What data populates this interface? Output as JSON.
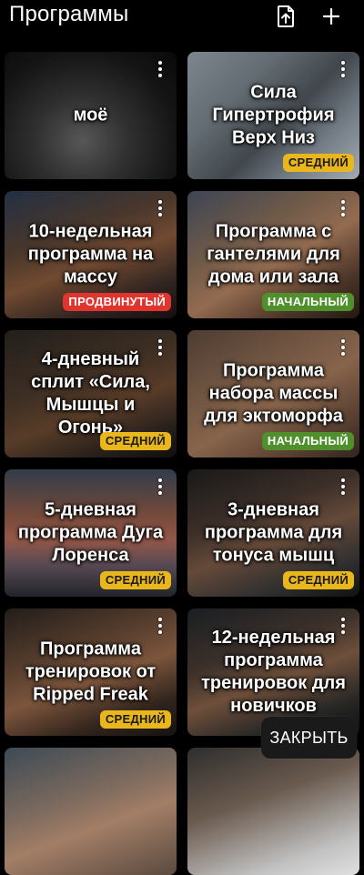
{
  "header": {
    "title": "Программы",
    "import_icon": "file-upload-icon",
    "add_icon": "plus-icon"
  },
  "programs": [
    {
      "title": "моё",
      "level": "",
      "level_kind": "none"
    },
    {
      "title": "Сила Гипертрофия Верх Низ",
      "level": "СРЕДНИЙ",
      "level_kind": "intermediate"
    },
    {
      "title": "10-недельная программа на массу",
      "level": "ПРОДВИНУТЫЙ",
      "level_kind": "advanced"
    },
    {
      "title": "Программа с гантелями для дома или зала",
      "level": "НАЧАЛЬНЫЙ",
      "level_kind": "beginner"
    },
    {
      "title": "4-дневный сплит «Сила, Мышцы и Огонь»",
      "level": "СРЕДНИЙ",
      "level_kind": "intermediate"
    },
    {
      "title": "Программа набора массы для эктоморфа",
      "level": "НАЧАЛЬНЫЙ",
      "level_kind": "beginner"
    },
    {
      "title": "5-дневная программа Дуга Лоренса",
      "level": "СРЕДНИЙ",
      "level_kind": "intermediate"
    },
    {
      "title": "3-дневная программа для тонуса мышц",
      "level": "СРЕДНИЙ",
      "level_kind": "intermediate"
    },
    {
      "title": "Программа тренировок от Ripped Freak",
      "level": "СРЕДНИЙ",
      "level_kind": "intermediate"
    },
    {
      "title": "12-недельная программа тренировок для новичков",
      "level": "",
      "level_kind": "none"
    },
    {
      "title": "",
      "level": "",
      "level_kind": "none"
    },
    {
      "title": "",
      "level": "",
      "level_kind": "none"
    }
  ],
  "colors": {
    "intermediate_bg": "#e9b61c",
    "intermediate_fg": "#1a1a1a",
    "advanced_bg": "#e0342f",
    "advanced_fg": "#ffffff",
    "beginner_bg": "#4f8f2c",
    "beginner_fg": "#ffffff"
  },
  "close_button": "ЗАКРЫТЬ"
}
